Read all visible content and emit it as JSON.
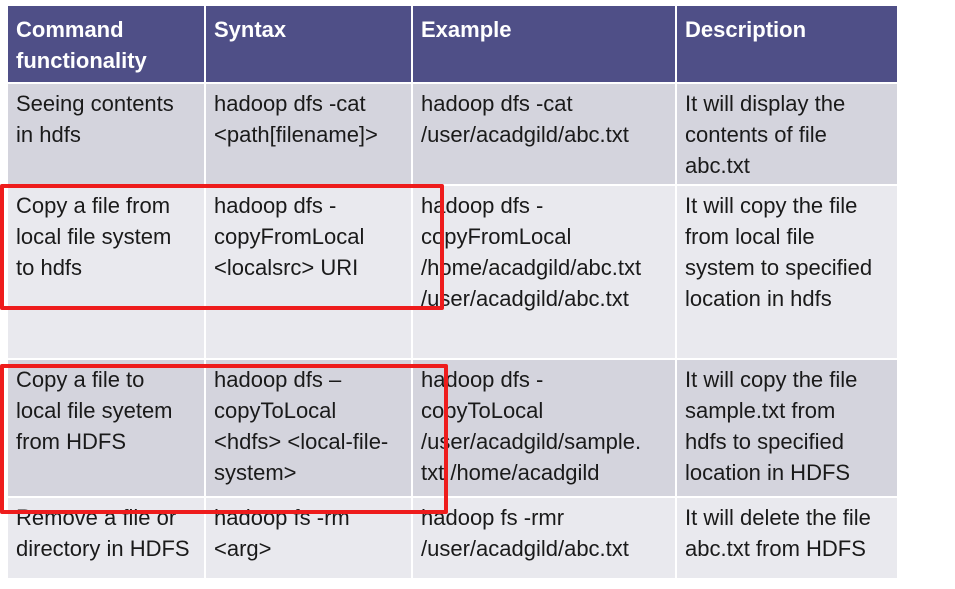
{
  "headers": [
    "Command functionality",
    "Syntax",
    "Example",
    "Description"
  ],
  "header_lines": [
    [
      "Command",
      "functionality"
    ],
    [
      "Syntax"
    ],
    [
      "Example"
    ],
    [
      "Description"
    ]
  ],
  "rows": [
    {
      "functionality": [
        "Seeing contents",
        "in hdfs"
      ],
      "syntax": [
        "hadoop dfs -cat",
        "<path[filename]>"
      ],
      "example": [
        "hadoop dfs -cat",
        "/user/acadgild/abc.txt"
      ],
      "description": [
        "It will display the",
        "contents of file",
        "abc.txt"
      ]
    },
    {
      "functionality": [
        "Copy a file from",
        "local file system",
        "to hdfs"
      ],
      "syntax": [
        "hadoop dfs -",
        "copyFromLocal",
        "<localsrc> URI"
      ],
      "example": [
        "hadoop dfs -",
        "copyFromLocal",
        "/home/acadgild/abc.txt",
        "/user/acadgild/abc.txt"
      ],
      "description": [
        "It will copy the file",
        "from local file",
        "system to specified",
        "location in hdfs"
      ]
    },
    {
      "functionality": [
        "Copy a file to",
        "local file syetem",
        "from HDFS"
      ],
      "syntax": [
        "hadoop dfs –",
        "copyToLocal",
        "<hdfs> <local-file-",
        "system>"
      ],
      "example": [
        "hadoop dfs -",
        "copyToLocal",
        "/user/acadgild/sample.",
        "txt  /home/acadgild"
      ],
      "description": [
        "It will copy the file",
        "sample.txt from",
        "hdfs to specified",
        "location in HDFS"
      ]
    },
    {
      "functionality": [
        "Remove a file or",
        "directory in HDFS"
      ],
      "syntax": [
        "hadoop fs -rm",
        "<arg>"
      ],
      "example": [
        "hadoop fs -rmr",
        "/user/acadgild/abc.txt"
      ],
      "description": [
        "It will delete the file",
        "abc.txt from HDFS"
      ]
    }
  ],
  "highlight_color": "#ee1c1c",
  "header_bg": "#4f4f87",
  "row_bg_odd": "#d4d4dd",
  "row_bg_even": "#e9e9ee"
}
